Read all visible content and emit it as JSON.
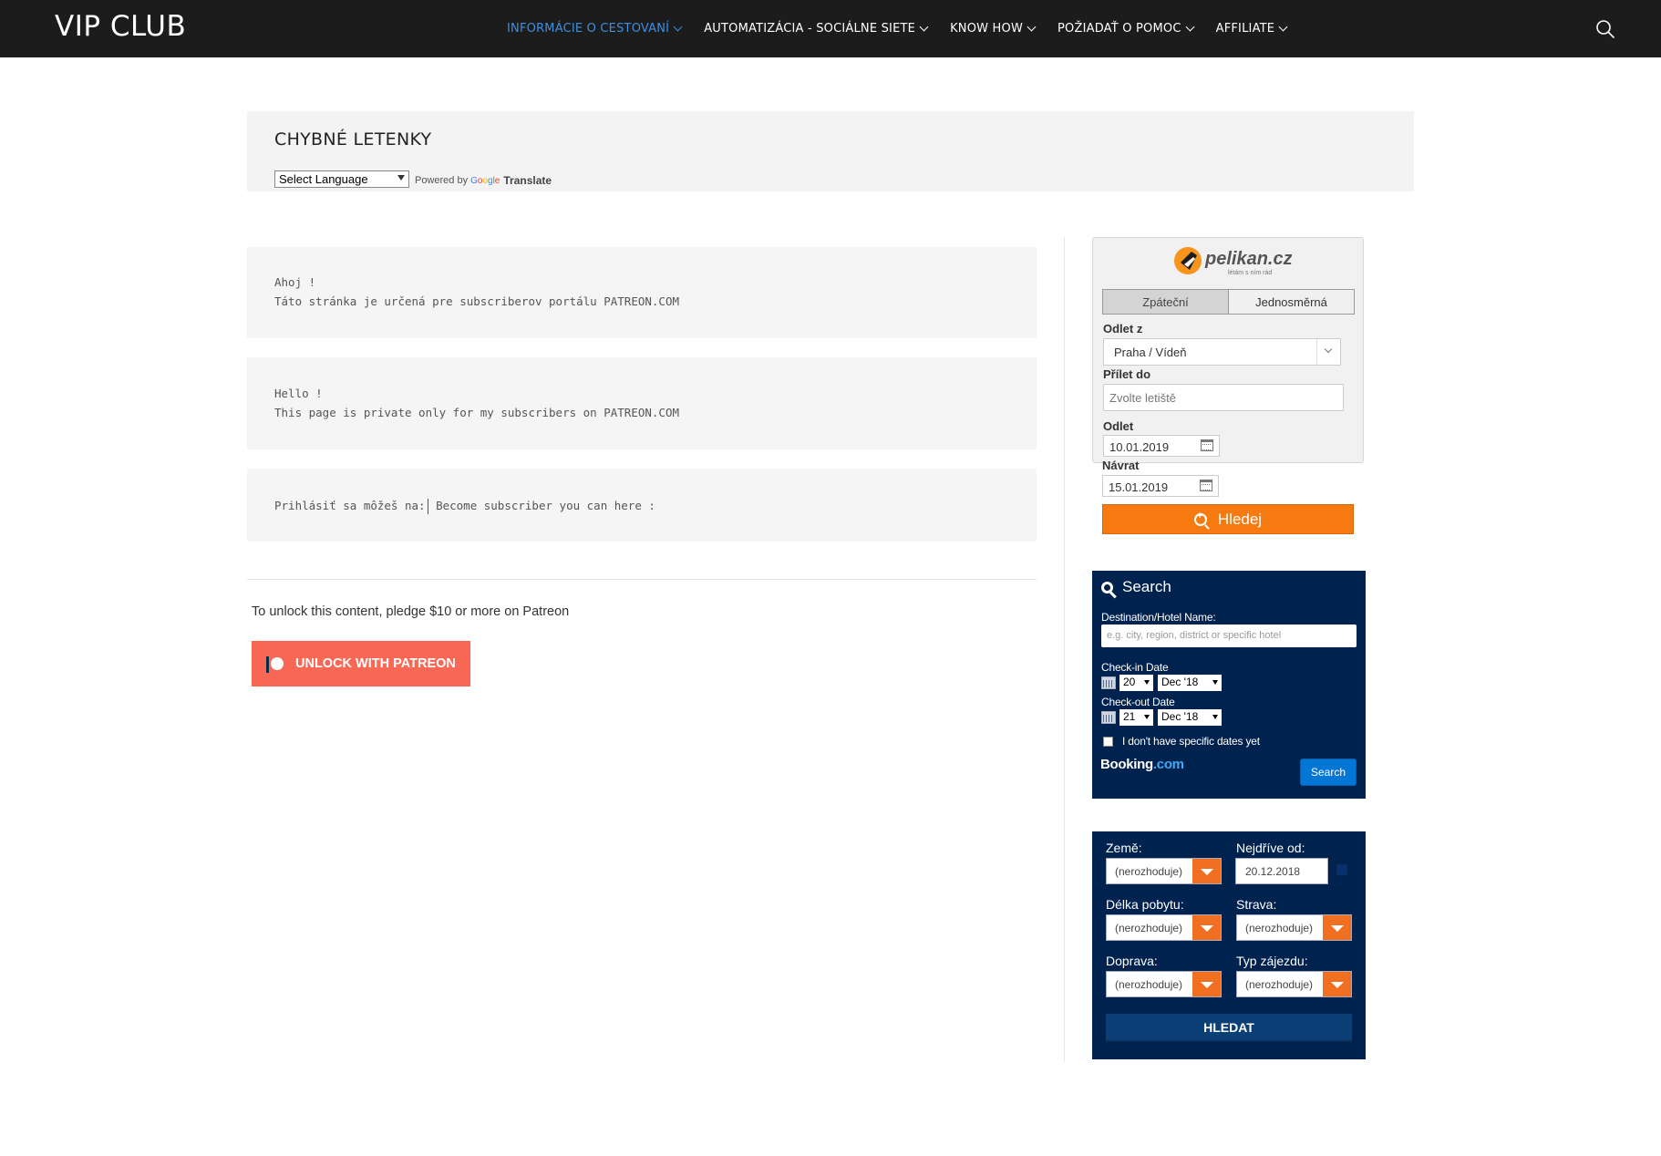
{
  "header": {
    "brand": "VIP CLUB",
    "nav": [
      {
        "label": "INFORMÁCIE O CESTOVANÍ",
        "active": true
      },
      {
        "label": "AUTOMATIZÁCIA - SOCIÁLNE SIETE",
        "active": false
      },
      {
        "label": "KNOW HOW",
        "active": false
      },
      {
        "label": "POŽIADAŤ O POMOC",
        "active": false
      },
      {
        "label": "AFFILIATE",
        "active": false
      }
    ],
    "search_icon": "search-icon"
  },
  "page": {
    "title": "CHYBNÉ LETENKY",
    "language_select": "Select Language",
    "powered_by": "Powered by",
    "google_letters": [
      "G",
      "o",
      "o",
      "g",
      "l",
      "e"
    ],
    "translate": "Translate"
  },
  "content": {
    "box1": [
      "Ahoj !",
      "Táto stránka je určená pre subscriberov portálu PATREON.COM"
    ],
    "box2": [
      "Hello !",
      "This page is private only for my subscribers on PATREON.COM"
    ],
    "box3": {
      "left": "Prihlásiť sa môžeš na:",
      "right": "Become subscriber you can here :"
    },
    "unlock_text": "To unlock this content, pledge $10 or more on Patreon",
    "unlock_button": "UNLOCK WITH PATREON"
  },
  "pelikan": {
    "logo_text": "pelikan.cz",
    "logo_tagline": "létám s ním rád",
    "tabs": [
      "Zpáteční",
      "Jednosměrná"
    ],
    "from_label": "Odlet z",
    "from_value": "Praha / Vídeň",
    "to_label": "Přílet do",
    "to_placeholder": "Zvolte letiště",
    "depart_label": "Odlet",
    "depart_value": "10.01.2019",
    "return_label": "Návrat",
    "return_value": "15.01.2019",
    "search_label": "Hledej"
  },
  "booking": {
    "title": "Search",
    "destination_label": "Destination/Hotel Name:",
    "destination_placeholder": "e.g. city, region, district or specific hotel",
    "checkin_label": "Check-in Date",
    "checkin_day": "20",
    "checkin_month": "Dec '18",
    "checkout_label": "Check-out Date",
    "checkout_day": "21",
    "checkout_month": "Dec '18",
    "no_dates_label": "I don't have specific dates yet",
    "logo_main": "Booking",
    "logo_suffix": ".com",
    "search_button": "Search"
  },
  "zajezdy": {
    "country_label": "Země:",
    "country_value": "(nerozhoduje)",
    "earliest_label": "Nejdříve od:",
    "earliest_value": "20.12.2018",
    "length_label": "Délka pobytu:",
    "length_value": "(nerozhoduje)",
    "board_label": "Strava:",
    "board_value": "(nerozhoduje)",
    "transport_label": "Doprava:",
    "transport_value": "(nerozhoduje)",
    "type_label": "Typ zájezdu:",
    "type_value": "(nerozhoduje)",
    "search_button": "HLEDAT"
  },
  "colors": {
    "nav_bg": "#1c1c1c",
    "nav_active": "#3d8fe0",
    "patreon": "#f96854",
    "pelikan_orange": "#f77a10",
    "booking_navy": "#00224f"
  }
}
